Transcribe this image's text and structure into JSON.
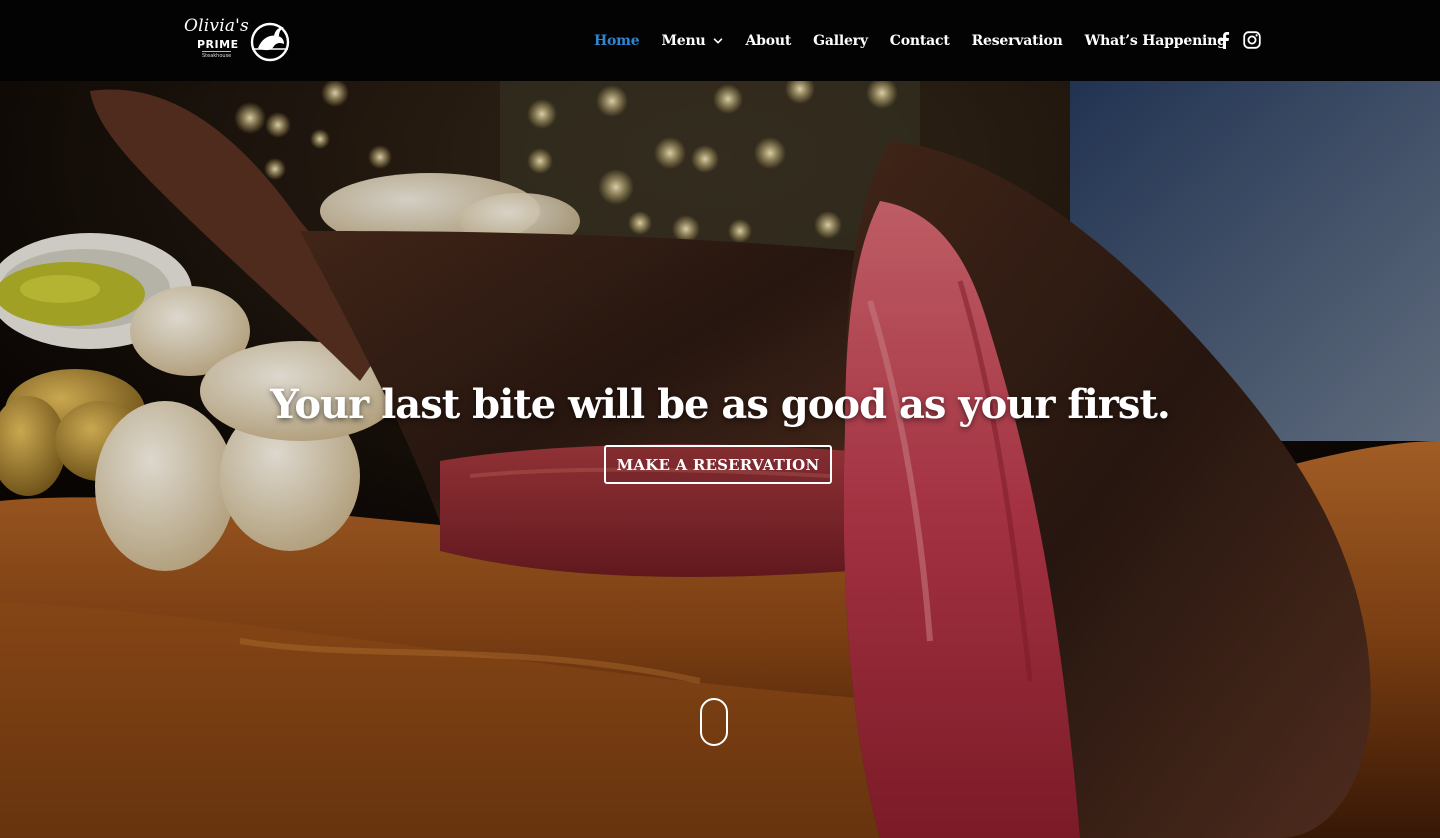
{
  "brand": {
    "script": "Olivia's",
    "name": "PRIME",
    "sub": "Steakhouse",
    "logo_icon": "bull-icon"
  },
  "nav": {
    "active_color": "#2f86d6",
    "items": [
      {
        "label": "Home"
      },
      {
        "label": "Menu"
      },
      {
        "label": "About"
      },
      {
        "label": "Gallery"
      },
      {
        "label": "Contact"
      },
      {
        "label": "Reservation"
      },
      {
        "label": "What’s Happening"
      }
    ]
  },
  "social": {
    "icons": [
      "facebook-icon",
      "instagram-icon"
    ]
  },
  "hero": {
    "headline": "Your last bite will be as good as your first.",
    "cta_label": "MAKE A RESERVATION",
    "scroll_icon": "mouse-scroll-icon"
  }
}
